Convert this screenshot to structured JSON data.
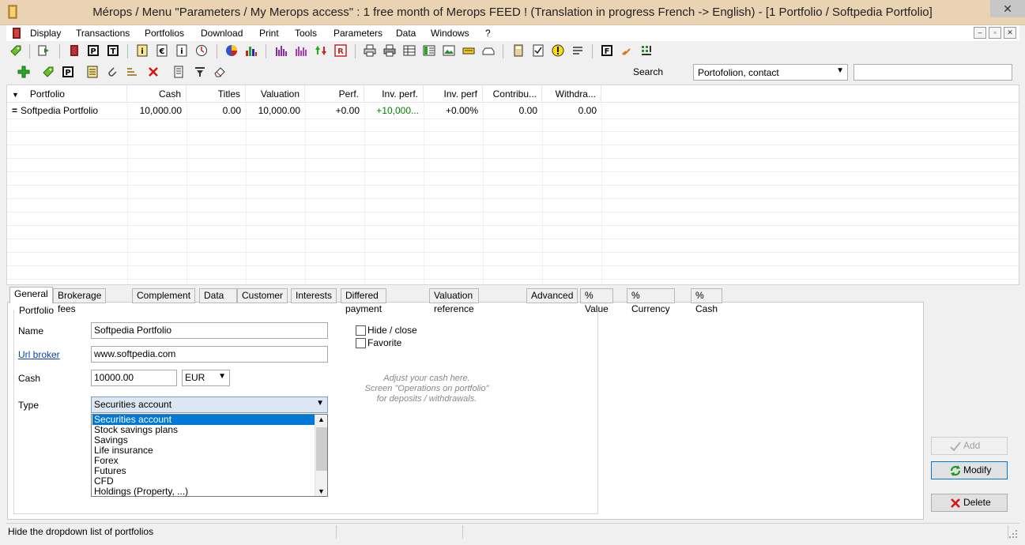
{
  "window": {
    "title": "Mérops / Menu \"Parameters / My Merops access\" : 1 free month of Merops FEED ! (Translation in progress French -> English) - [1 Portfolio / Softpedia Portfolio]",
    "close_glyph": "✕"
  },
  "menu": {
    "items": [
      "Display",
      "Transactions",
      "Portfolios",
      "Download",
      "Print",
      "Tools",
      "Parameters",
      "Data",
      "Windows",
      "?"
    ],
    "mdi": [
      "–",
      "▫",
      "✕"
    ]
  },
  "search": {
    "label": "Search",
    "select_value": "Portofolion, contact",
    "input_value": ""
  },
  "grid": {
    "columns": [
      "Portfolio",
      "Cash",
      "Titles",
      "Valuation",
      "Perf.",
      "Inv. perf.",
      "Inv. perf",
      "Contribu...",
      "Withdra..."
    ],
    "rows": [
      [
        "Softpedia Portfolio",
        "10,000.00",
        "0.00",
        "10,000.00",
        "+0.00",
        "+10,000...",
        "+0.00%",
        "0.00",
        "0.00"
      ]
    ]
  },
  "tabs": [
    "General",
    "Brokerage fees",
    "Complement",
    "Data",
    "Customer",
    "Interests",
    "Differed payment",
    "Valuation reference",
    "Advanced",
    "% Value",
    "% Currency",
    "% Cash"
  ],
  "form": {
    "group_title": "Portfolio",
    "name_label": "Name",
    "name_value": "Softpedia Portfolio",
    "url_label": "Url broker",
    "url_value": "www.softpedia.com",
    "cash_label": "Cash",
    "cash_value": "10000.00",
    "currency_value": "EUR",
    "type_label": "Type",
    "type_value": "Securities account",
    "type_options": [
      "Securities account",
      "Stock savings plans",
      "Savings",
      "Life insurance",
      "Forex",
      "Futures",
      "CFD",
      "Holdings (Property, ...)"
    ],
    "hide_label": "Hide / close",
    "favorite_label": "Favorite",
    "hint_lines": [
      "Adjust your cash here.",
      "Screen \"Operations on portfolio\"",
      "for deposits / withdrawals."
    ]
  },
  "buttons": {
    "add": "Add",
    "modify": "Modify",
    "delete": "Delete"
  },
  "status": {
    "text": "Hide the dropdown list of portfolios"
  },
  "colors": {
    "titlebar": "#e9d3b3",
    "selection": "#0078d7",
    "positive": "#008000"
  }
}
